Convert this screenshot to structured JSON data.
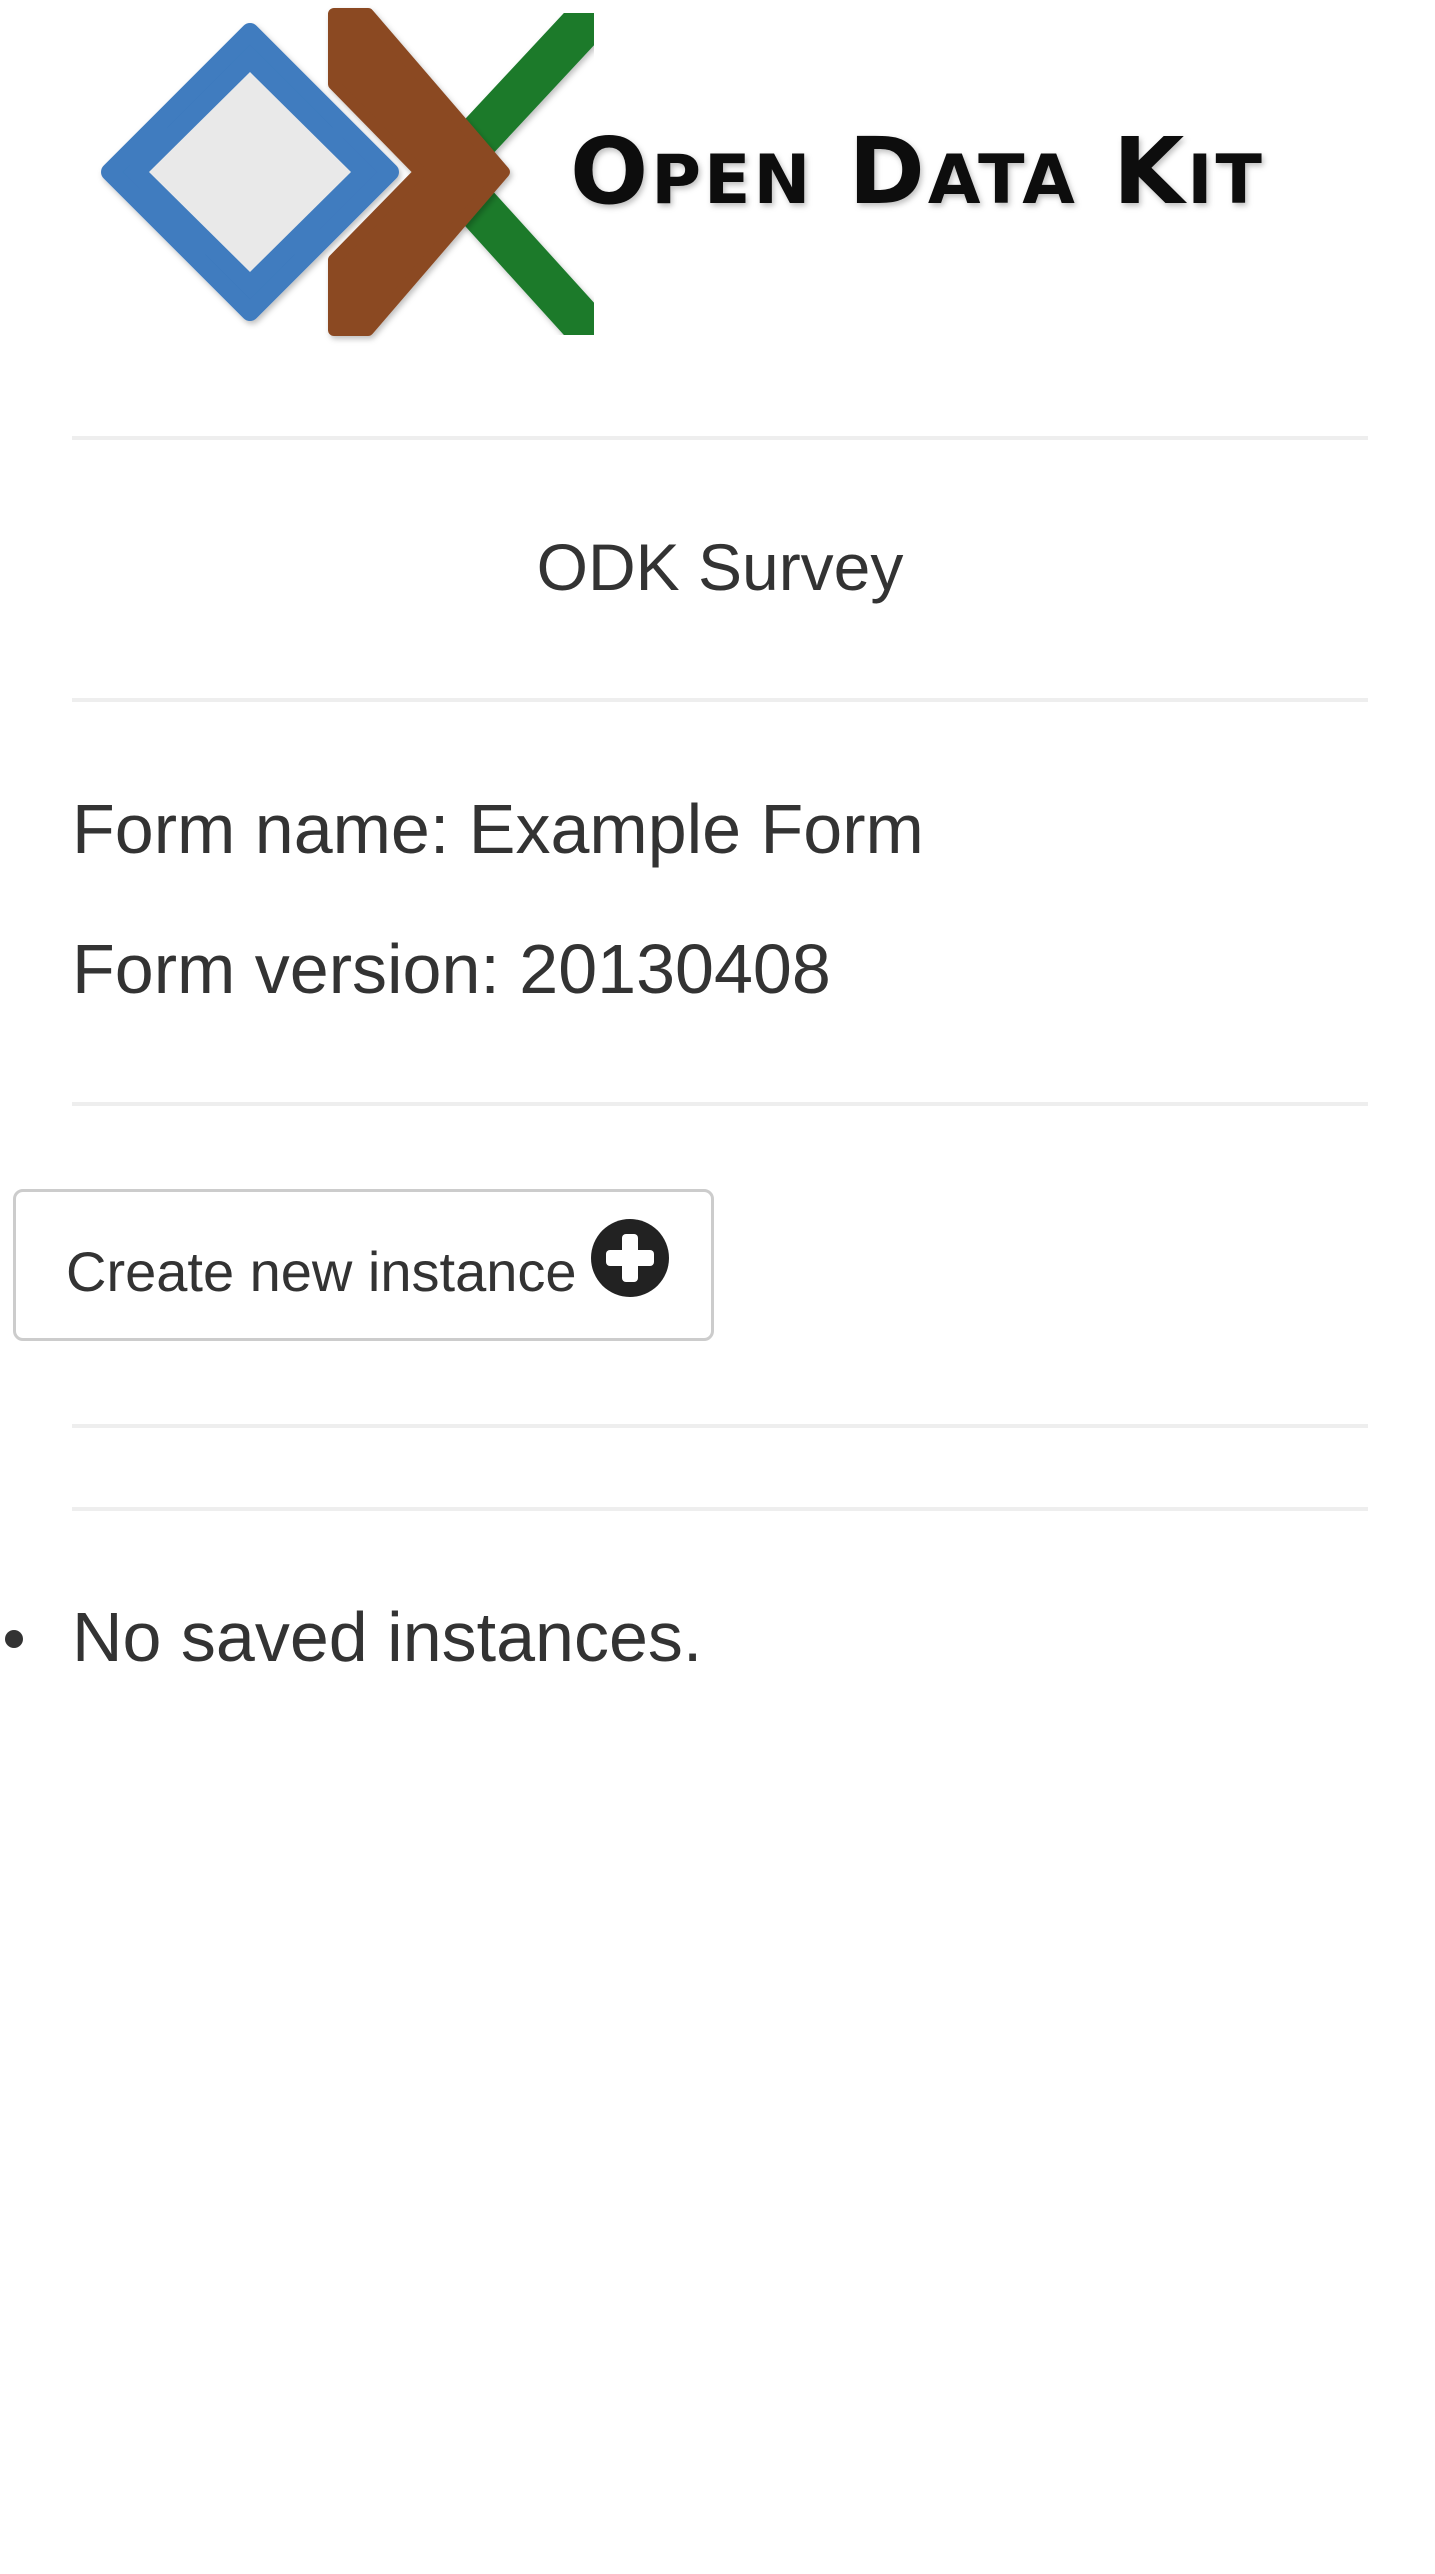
{
  "logo": {
    "text": "Open Data Kit",
    "colors": {
      "blue": "#3f7bbf",
      "brown": "#8b4a23",
      "green": "#1a7a2c",
      "inner": "#e9e9e9",
      "text": "#111111"
    }
  },
  "app_title": "ODK Survey",
  "form": {
    "name_label": "Form name: Example Form",
    "version_label": "Form version: 20130408"
  },
  "actions": {
    "create_label": "Create new instance",
    "create_icon": "plus-circle-icon"
  },
  "instances": {
    "empty_message": "No saved instances."
  },
  "colors": {
    "text": "#333333",
    "rule": "#eeeeee",
    "button_border": "#cccccc"
  }
}
